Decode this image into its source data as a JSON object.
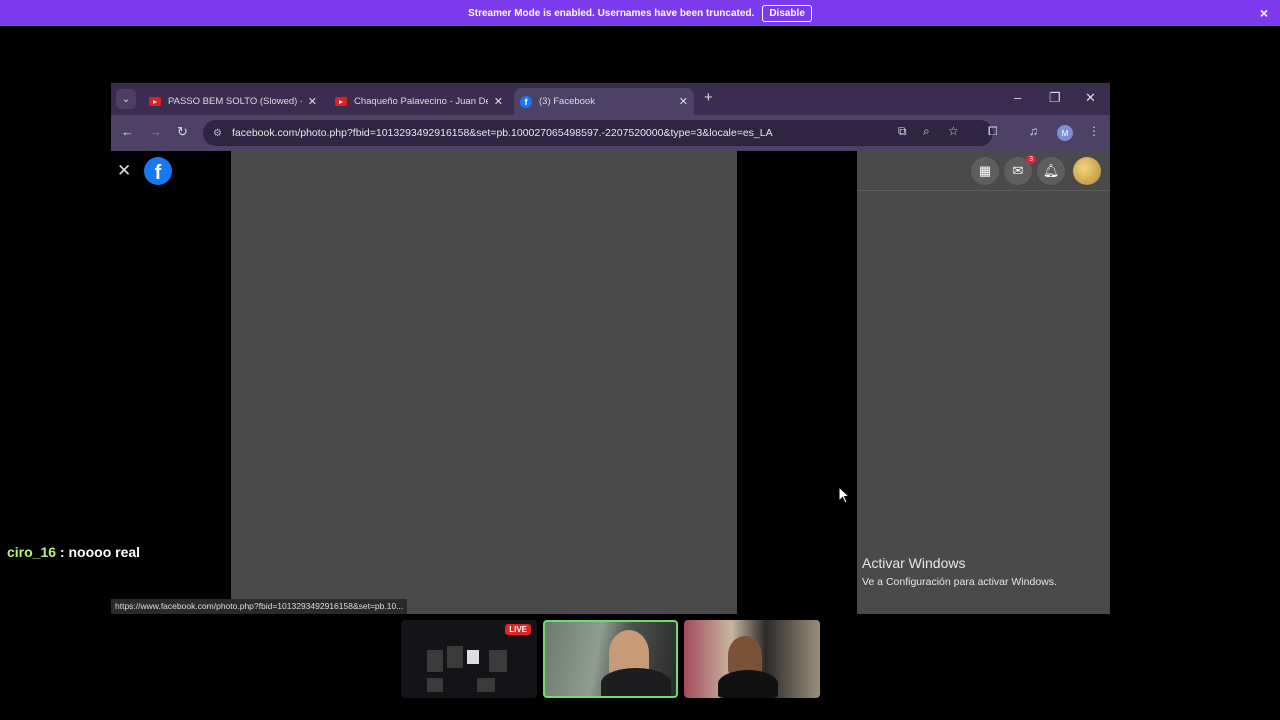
{
  "banner": {
    "text": "Streamer Mode is enabled. Usernames have been truncated.",
    "disable_label": "Disable",
    "close_icon": "×"
  },
  "browser": {
    "tabs": [
      {
        "label": "PASSO BEM SOLTO (Slowed) - Y",
        "favicon": "youtube-icon",
        "active": false
      },
      {
        "label": "Chaqueño Palavecino - Juan De",
        "favicon": "youtube-icon",
        "active": false
      },
      {
        "label": "(3) Facebook",
        "favicon": "facebook-icon",
        "active": true
      }
    ],
    "tab_close": "✕",
    "new_tab": "+",
    "window_controls": {
      "minimize": "–",
      "restore": "❐",
      "close": "✕"
    },
    "address": {
      "url": "facebook.com/photo.php?fbid=1013293492916158&set=pb.100027065498597.-2207520000&type=3&locale=es_LA"
    },
    "profile_initial": "M",
    "status_url": "https://www.facebook.com/photo.php?fbid=1013293492916158&set=pb.10..."
  },
  "facebook": {
    "logo_letter": "f",
    "close_icon": "✕",
    "messenger_badge": "3",
    "activate_windows": {
      "title": "Activar Windows",
      "subtitle": "Ve a Configuración para activar Windows."
    }
  },
  "chat": {
    "user": "ciro_16",
    "separator": " : ",
    "message": "noooo real"
  },
  "cams": {
    "live_label": "LIVE"
  },
  "colors": {
    "banner": "#7c3aed",
    "tabbar": "#3a2d4f",
    "toolbar": "#4e4166",
    "fb_blue": "#1877f2",
    "chat_user": "#b9f27a",
    "active_cam_border": "#6fdc6f"
  }
}
